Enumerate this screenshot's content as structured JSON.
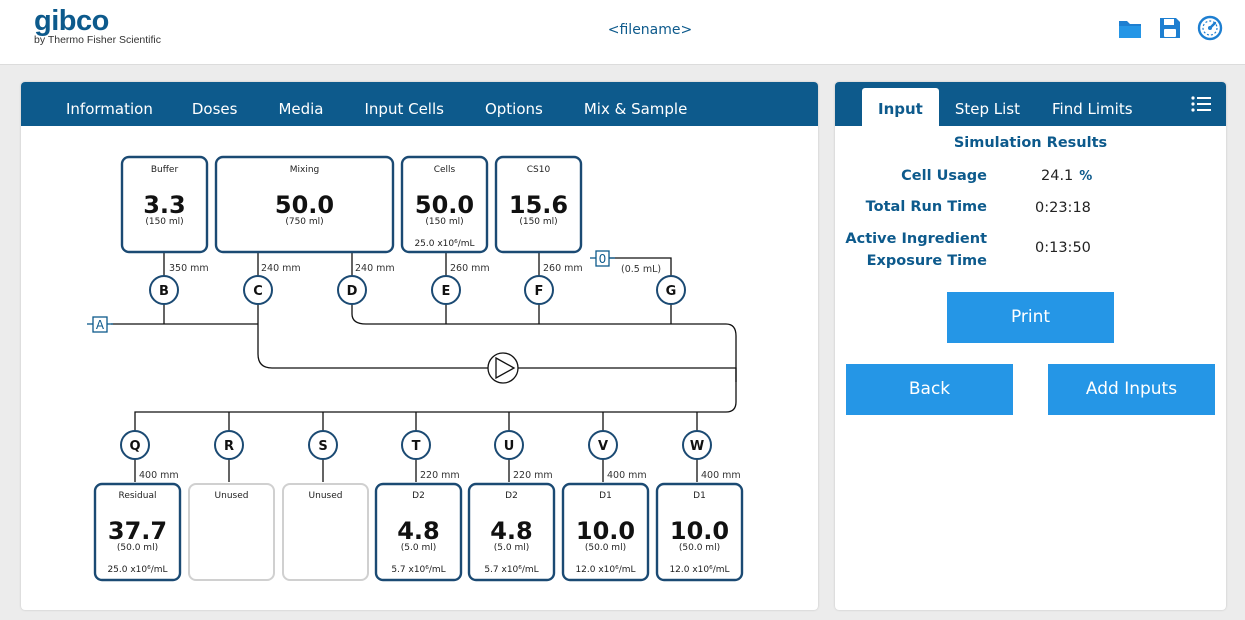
{
  "header": {
    "logo_text": "gibco",
    "logo_sub": "by Thermo Fisher Scientific",
    "filename": "<filename>",
    "icons": [
      "folder-icon",
      "save-icon",
      "speedometer-icon"
    ]
  },
  "colors": {
    "brand": "#0d5a8c",
    "button": "#2596e6",
    "vessel_border": "#1b4a73",
    "unused_border": "#d0d0d0"
  },
  "left_tabs": [
    "Information",
    "Doses",
    "Media",
    "Input Cells",
    "Options",
    "Mix & Sample"
  ],
  "right_tabs": {
    "active": "Input",
    "items": [
      "Input",
      "Step List",
      "Find Limits"
    ]
  },
  "results": {
    "title": "Simulation Results",
    "cell_usage_label": "Cell Usage",
    "cell_usage_value": "24.1",
    "cell_usage_unit": "%",
    "total_run_time_label": "Total Run Time",
    "total_run_time_value": "0:23:18",
    "exposure_label_1": "Active Ingredient",
    "exposure_label_2": "Exposure Time",
    "exposure_value": "0:13:50"
  },
  "buttons": {
    "print": "Print",
    "back": "Back",
    "add_inputs": "Add Inputs"
  },
  "diagram": {
    "inlet_a": "A",
    "inlet_0": "0",
    "inlet_0_volume": "(0.5 mL)",
    "top_vessels": [
      {
        "name": "Buffer",
        "value": "3.3",
        "volume": "(150 ml)",
        "extra": ""
      },
      {
        "name": "Mixing",
        "value": "50.0",
        "volume": "(750 ml)",
        "extra": ""
      },
      {
        "name": "Cells",
        "value": "50.0",
        "volume": "(150 ml)",
        "extra": "25.0 x10⁶/mL"
      },
      {
        "name": "CS10",
        "value": "15.6",
        "volume": "(150 ml)",
        "extra": ""
      }
    ],
    "top_lengths": [
      "350 mm",
      "240 mm",
      "240 mm",
      "260 mm",
      "260 mm"
    ],
    "top_valves": [
      "B",
      "C",
      "D",
      "E",
      "F",
      "G"
    ],
    "bottom_valves": [
      "Q",
      "R",
      "S",
      "T",
      "U",
      "V",
      "W"
    ],
    "bottom_lengths": [
      "400 mm",
      "220 mm",
      "220 mm",
      "400 mm",
      "400 mm"
    ],
    "bottom_vessels": [
      {
        "name": "Residual",
        "value": "37.7",
        "volume": "(50.0 ml)",
        "extra": "25.0 x10⁶/mL",
        "used": true
      },
      {
        "name": "Unused",
        "value": "",
        "volume": "",
        "extra": "",
        "used": false
      },
      {
        "name": "Unused",
        "value": "",
        "volume": "",
        "extra": "",
        "used": false
      },
      {
        "name": "D2",
        "value": "4.8",
        "volume": "(5.0 ml)",
        "extra": "5.7 x10⁶/mL",
        "used": true
      },
      {
        "name": "D2",
        "value": "4.8",
        "volume": "(5.0 ml)",
        "extra": "5.7 x10⁶/mL",
        "used": true
      },
      {
        "name": "D1",
        "value": "10.0",
        "volume": "(50.0 ml)",
        "extra": "12.0 x10⁶/mL",
        "used": true
      },
      {
        "name": "D1",
        "value": "10.0",
        "volume": "(50.0 ml)",
        "extra": "12.0 x10⁶/mL",
        "used": true
      }
    ]
  }
}
